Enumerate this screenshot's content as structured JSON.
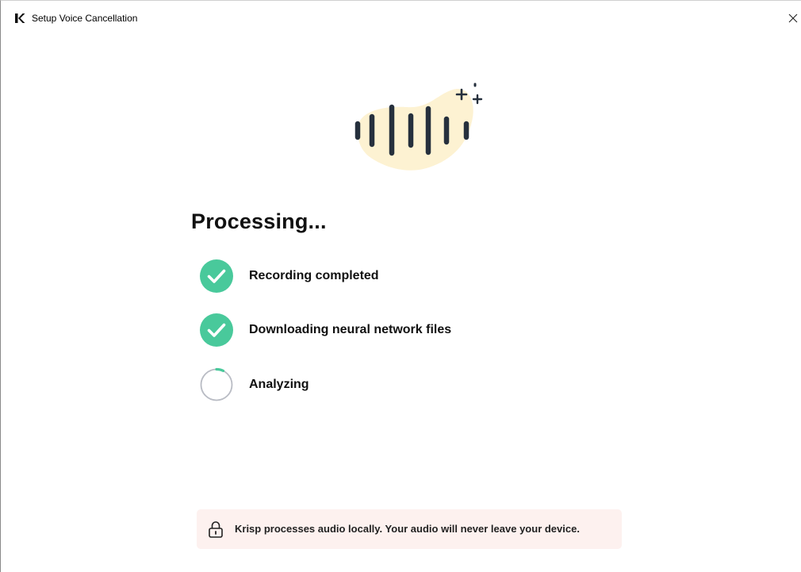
{
  "window": {
    "title": "Setup Voice Cancellation",
    "logo_icon": "krisp-k-logo-icon",
    "close_icon": "close-icon"
  },
  "main": {
    "illustration_icon": "sound-wave-sparkle-icon",
    "heading": "Processing...",
    "steps": [
      {
        "label": "Recording completed",
        "status": "completed",
        "icon": "check-circle-icon"
      },
      {
        "label": "Downloading neural network files",
        "status": "completed",
        "icon": "check-circle-icon"
      },
      {
        "label": "Analyzing",
        "status": "in-progress",
        "icon": "spinner-icon"
      }
    ]
  },
  "notice": {
    "icon": "lock-icon",
    "text": "Krisp processes audio locally. Your audio will never leave your device."
  },
  "colors": {
    "accent_green": "#49c99b",
    "blob_cream": "#fdf2d2",
    "wave_dark": "#26303d",
    "notice_bg": "#fdf1ef",
    "spinner_track": "#b9bcc4"
  }
}
